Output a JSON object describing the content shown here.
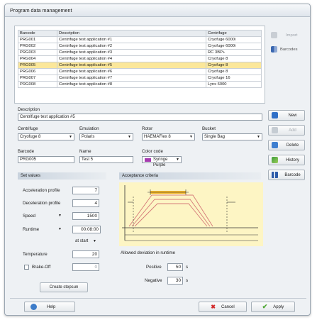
{
  "window_title": "Program data management",
  "table": {
    "headers": [
      "Barcode",
      "Description",
      "Centrifuge"
    ],
    "rows": [
      [
        "PRG001",
        "Centrifuge test application #1",
        "Cryofuge 6000i"
      ],
      [
        "PRG002",
        "Centrifuge test application #2",
        "Cryofuge 6000i"
      ],
      [
        "PRG003",
        "Centrifuge test application #3",
        "RC 3BP+"
      ],
      [
        "PRG004",
        "Centrifuge test application #4",
        "Cryofuge 8"
      ],
      [
        "PRG005",
        "Centrifuge test application #5",
        "Cryofuge 8"
      ],
      [
        "PRG006",
        "Centrifuge test application #6",
        "Cryofuge 8"
      ],
      [
        "PRG007",
        "Centrifuge test application #7",
        "Cryofuge 16"
      ],
      [
        "PRG008",
        "Centrifuge test application #8",
        "Lynx 6000"
      ]
    ],
    "selected_index": 4
  },
  "top_buttons": {
    "import": "Import",
    "barcodes": "Barcodes"
  },
  "description": {
    "label": "Description",
    "value": "Centrifuge test application #5"
  },
  "fields": {
    "centrifuge_label": "Centrifuge",
    "centrifuge_value": "Cryofuge 8",
    "emulation_label": "Emulation",
    "emulation_value": "Polaris",
    "rotor_label": "Rotor",
    "rotor_value": "HAEMAFlex 8",
    "bucket_label": "Bucket",
    "bucket_value": "Single Bag",
    "barcode_label": "Barcode",
    "barcode_value": "PRG005",
    "name_label": "Name",
    "name_value": "Test 5",
    "colorcode_label": "Color code",
    "colorcode_value": "Syringe Purple",
    "colorcode_swatch": "#a63bb0"
  },
  "side_buttons": {
    "new": "New",
    "add": "Add",
    "delete": "Delete",
    "history": "History",
    "barcode": "Barcode"
  },
  "set_values": {
    "title": "Set values",
    "accel_label": "Acceleration profile",
    "accel_value": "7",
    "decel_label": "Deceleration profile",
    "decel_value": "4",
    "speed_label": "Speed",
    "speed_value": "1500",
    "runtime_label": "Runtime",
    "runtime_value": "00:08:00",
    "at_start": "at start",
    "temp_label": "Temperature",
    "temp_value": "20",
    "brake_label": "Brake-Off",
    "brake_value": "0",
    "create_button": "Create stepsun"
  },
  "acceptance": {
    "title": "Acceptance criteria",
    "deviation_label": "Allowed deviation in runtime",
    "positive_label": "Positive",
    "positive_value": "50",
    "positive_unit": "s",
    "negative_label": "Negative",
    "negative_value": "30",
    "negative_unit": "s",
    "panel_color": "#fdf5c4",
    "bar_color": "#f0b429"
  },
  "footer": {
    "help": "Help",
    "cancel": "Cancel",
    "apply": "Apply"
  }
}
